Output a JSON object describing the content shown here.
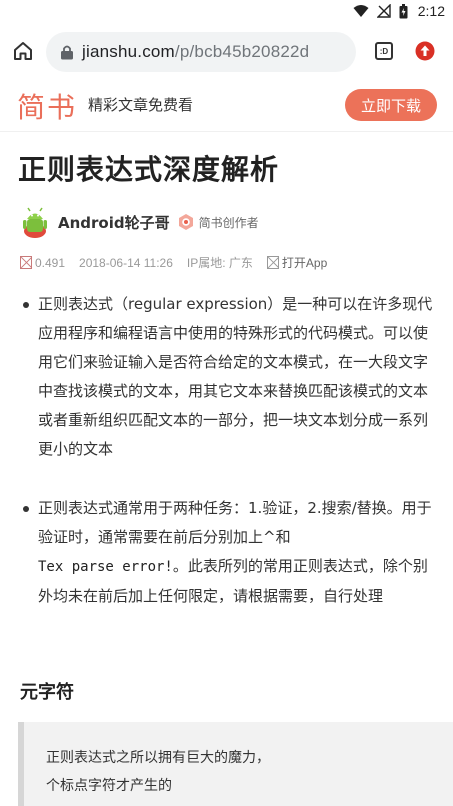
{
  "status_bar": {
    "time": "2:12",
    "icons": [
      "wifi-icon",
      "signal-off-icon",
      "battery-icon"
    ]
  },
  "browser": {
    "url_host": "jianshu.com",
    "url_path": "/p/bcb45b20822d",
    "tab_count": ":D",
    "page_load_progress": 0.7,
    "accent_color": "#4f86e8"
  },
  "header": {
    "brand": "简书",
    "tagline": "精彩文章免费看",
    "download_label": "立即下载",
    "brand_color": "#ea6f5a"
  },
  "article": {
    "title": "正则表达式深度解析",
    "author": "Android轮子哥",
    "badge": "简书创作者",
    "meta": {
      "score": "0.491",
      "datetime": "2018-06-14 11:26",
      "ip_location": "IP属地: 广东",
      "open_app": "打开App"
    },
    "bullet1": "正则表达式（regular expression）是一种可以在许多现代应用程序和编程语言中使用的特殊形式的代码模式。可以使用它们来验证输入是否符合给定的文本模式，在一大段文字中查找该模式的文本，用其它文本来替换匹配该模式的文本或者重新组织匹配文本的一部分，把一块文本划分成一系列更小的文本",
    "bullet2_before": "正则表达式通常用于两种任务：1.验证，2.搜索/替换。用于验证时，通常需要在前后分别加上^和",
    "bullet2_error": "Tex parse error!",
    "bullet2_after": "。此表所列的常用正则表达式，除个别外均未在前后加上任何限定，请根据需要，自行处理",
    "section_heading": "元字符",
    "quote": "正则表达式之所以拥有巨大的魔力，\n个标点字符才产生的"
  }
}
